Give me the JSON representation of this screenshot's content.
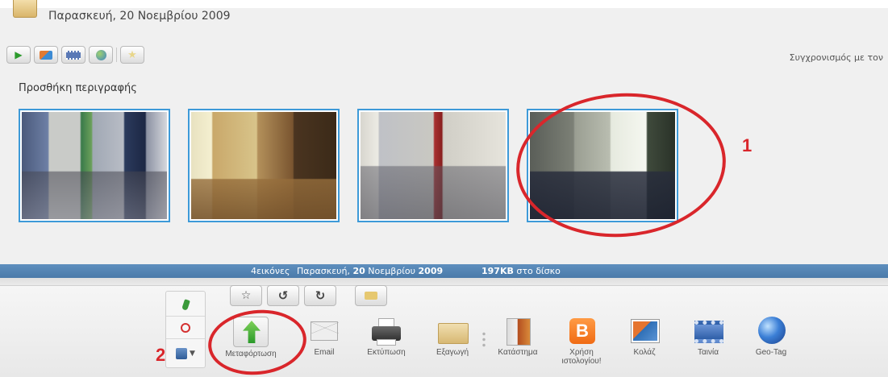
{
  "album": {
    "date": "Παρασκευή, 20 Νοεμβρίου 2009",
    "sync_label": "Συγχρονισμός με τον",
    "description_placeholder": "Προσθήκη περιγραφής",
    "photos": [
      {
        "desc": "office photo with desks and computers"
      },
      {
        "desc": "office photo with desk and cabinet"
      },
      {
        "desc": "office photo with computer desks"
      },
      {
        "desc": "office photo with desk by window"
      }
    ]
  },
  "toolbar": {
    "icons": [
      "play-icon",
      "add-picture-icon",
      "movie-icon",
      "globe-icon",
      "star-icon"
    ]
  },
  "status": {
    "count": "4εικόνες",
    "date_prefix": "Παρασκευή, ",
    "date_bold_day": "20",
    "date_month": " Νοεμβρίου ",
    "date_bold_year": "2009",
    "size_bold": "197KB",
    "size_suffix": " στο δίσκο"
  },
  "tray": {
    "actions": [
      {
        "label": "Μεταφόρτωση"
      },
      {
        "label": "Email"
      },
      {
        "label": "Εκτύπωση"
      },
      {
        "label": "Εξαγωγή"
      },
      {
        "label": "Κατάστημα"
      },
      {
        "label": "Χρήση ιστολογίου!"
      },
      {
        "label": "Κολάζ"
      },
      {
        "label": "Ταινία"
      },
      {
        "label": "Geo-Tag"
      }
    ]
  },
  "annotations": {
    "one": "1",
    "two": "2"
  },
  "colors": {
    "accent_blue": "#3d9ad8",
    "status_bar": "#4a7aa9",
    "annotation_red": "#d9262b"
  }
}
